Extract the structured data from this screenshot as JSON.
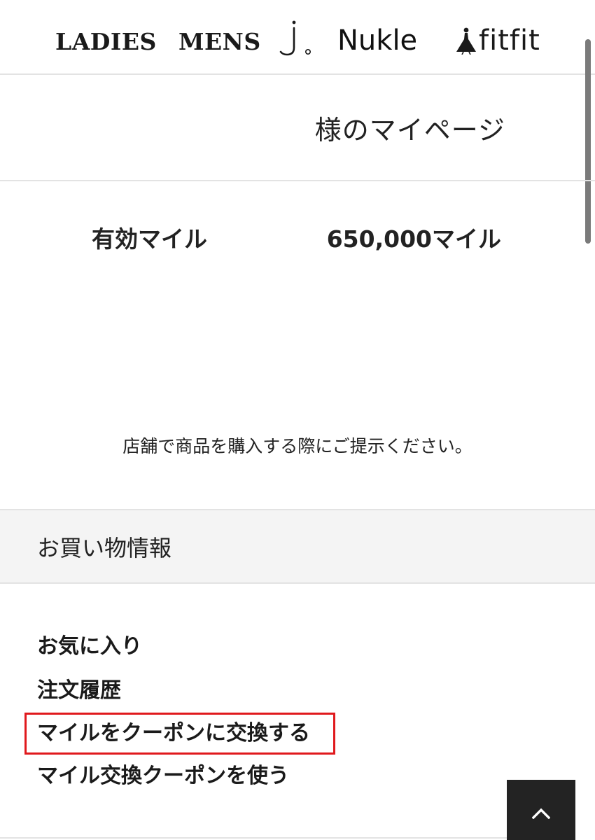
{
  "brand_nav": {
    "ladies": "LADIES",
    "mens": "MENS",
    "j_brand_icon": "j-brand-logo",
    "nukle": "Nukle",
    "fitfit": "fitfit",
    "fitfit_icon": "fitfit-figure-logo"
  },
  "header": {
    "title": "様のマイページ"
  },
  "miles": {
    "label": "有効マイル",
    "value": "650,000マイル"
  },
  "store_note": "店舗で商品を購入する際にご提示ください。",
  "shopping_section": {
    "title": "お買い物情報",
    "items": [
      {
        "label": "お気に入り"
      },
      {
        "label": "注文履歴"
      },
      {
        "label": "マイルをクーポンに交換する",
        "highlighted": true
      },
      {
        "label": "マイル交換クーポンを使う"
      }
    ]
  },
  "back_to_top_icon": "chevron-up-icon",
  "colors": {
    "highlight": "#e0191d",
    "section_bg": "#f4f4f4",
    "back_to_top_bg": "#232323"
  }
}
